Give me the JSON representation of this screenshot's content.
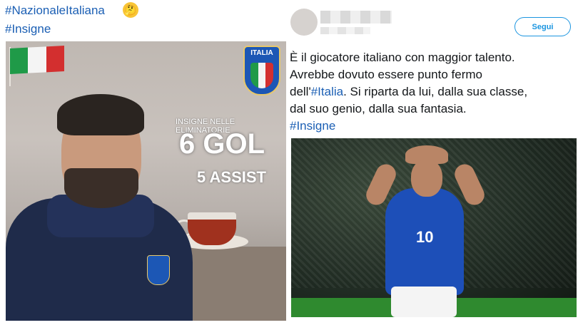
{
  "left_tweet": {
    "hashtags": [
      "#NazionaleItaliana",
      "#Insigne"
    ],
    "emoji_icon": "thinking-face-icon",
    "graphic": {
      "crest_text": "ITALIA",
      "subtitle": "INSIGNE NELLE ELIMINATORIE",
      "goals": "6 GOL",
      "assists": "5 ASSIST"
    }
  },
  "right_tweet": {
    "follow_label": "Segui",
    "text_line1": "È il giocatore italiano con maggior talento.",
    "text_line2": "Avrebbe dovuto essere punto fermo",
    "text_line3_prefix": "dell'",
    "text_line3_hashtag": "#Italia",
    "text_line3_suffix": ". Si riparta da lui, dalla sua classe,",
    "text_line4": "dal suo genio, dalla sua fantasia.",
    "text_hashtag": "#Insigne",
    "jersey_number": "10"
  },
  "colors": {
    "hashtag": "#1b5fb4",
    "follow_border": "#1b95e0",
    "italy_green": "#1f9a48",
    "italy_white": "#f4f4f4",
    "italy_red": "#d32f2f",
    "azzurri_blue": "#1d4fb8"
  }
}
